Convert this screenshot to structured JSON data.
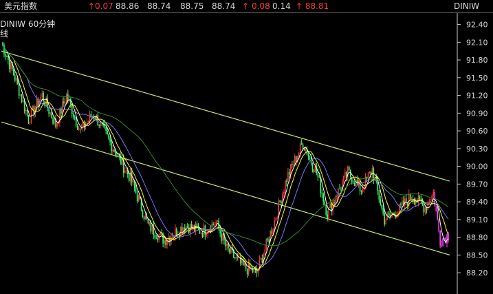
{
  "ticker": {
    "name": "美元指数",
    "fields": [
      {
        "text": "↑0.07",
        "color": "red"
      },
      {
        "text": "88.86",
        "color": "white"
      },
      {
        "text": "88.74",
        "color": "white"
      },
      {
        "text": "88.75",
        "color": "white"
      },
      {
        "text": "88.74",
        "color": "white"
      },
      {
        "text": "↑",
        "color": "red"
      },
      {
        "text": "0.08",
        "color": "red"
      },
      {
        "text": "0.14",
        "color": "white"
      },
      {
        "text": "↑ 88.81",
        "color": "red"
      }
    ],
    "symbol": "DINIW"
  },
  "chart": {
    "title": "DINIW   60分钟",
    "subtitle": "线"
  },
  "chart_data": {
    "type": "line",
    "y_ticks": [
      "92.40",
      "92.10",
      "91.80",
      "91.50",
      "91.20",
      "90.90",
      "90.60",
      "90.30",
      "90.00",
      "89.70",
      "89.40",
      "89.10",
      "88.80",
      "88.50",
      "88.20"
    ],
    "ylim": [
      88.05,
      92.5
    ],
    "n_bars": 330,
    "channel_upper": {
      "x": [
        0,
        330
      ],
      "y": [
        91.95,
        89.75
      ]
    },
    "channel_lower": {
      "x": [
        0,
        330
      ],
      "y": [
        90.75,
        88.5
      ]
    },
    "close_keypoints": [
      [
        0,
        92.1
      ],
      [
        10,
        91.5
      ],
      [
        20,
        90.8
      ],
      [
        30,
        91.2
      ],
      [
        40,
        90.7
      ],
      [
        48,
        91.2
      ],
      [
        58,
        90.6
      ],
      [
        68,
        90.9
      ],
      [
        80,
        90.4
      ],
      [
        95,
        89.8
      ],
      [
        108,
        89.0
      ],
      [
        120,
        88.75
      ],
      [
        135,
        89.0
      ],
      [
        148,
        88.9
      ],
      [
        158,
        89.05
      ],
      [
        166,
        88.6
      ],
      [
        178,
        88.3
      ],
      [
        188,
        88.2
      ],
      [
        200,
        89.0
      ],
      [
        210,
        89.8
      ],
      [
        222,
        90.4
      ],
      [
        232,
        89.9
      ],
      [
        240,
        89.2
      ],
      [
        255,
        89.9
      ],
      [
        265,
        89.6
      ],
      [
        273,
        89.95
      ],
      [
        282,
        89.1
      ],
      [
        292,
        89.25
      ],
      [
        302,
        89.5
      ],
      [
        312,
        89.3
      ],
      [
        318,
        89.55
      ],
      [
        323,
        88.75
      ],
      [
        330,
        88.85
      ]
    ]
  }
}
